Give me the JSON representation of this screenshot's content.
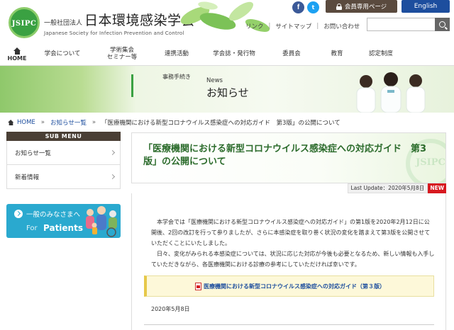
{
  "header": {
    "logo_text": "JSIPC",
    "org_prefix": "一般社団法人",
    "org_name": "日本環境感染学会",
    "org_name_en": "Japanese Society for Infection Prevention and Control",
    "facebook_label": "f",
    "twitter_label": "t",
    "member_page": "会員専用ページ",
    "english": "English",
    "util_links": [
      "リンク",
      "サイトマップ",
      "お問い合わせ"
    ],
    "search_placeholder": ""
  },
  "nav": {
    "home": "HOME",
    "items": [
      "学会について",
      "学術集会\nセミナー等",
      "連携活動",
      "学会誌・発行物",
      "委員会",
      "教育",
      "認定制度"
    ]
  },
  "banner": {
    "tag": "事務手続き",
    "title_en": "News",
    "title": "お知らせ"
  },
  "breadcrumb": {
    "home": "HOME",
    "parent": "お知らせ一覧",
    "current": "「医療機関における新型コロナウイルス感染症への対応ガイド　第3版」の公開について"
  },
  "sidebar": {
    "title": "SUB MENU",
    "items": [
      "お知らせ一覧",
      "新着情報"
    ],
    "patients_jp": "一般のみなさまへ",
    "patients_en_1": "For",
    "patients_en_2": "Patients"
  },
  "article": {
    "title": "「医療機関における新型コロナウイルス感染症への対応ガイド　第3版」の公開について",
    "update": "Last Update：2020年5月8日",
    "new_badge": "NEW",
    "para1": "　本学会では「医療機関における新型コロナウイルス感染症への対応ガイド」の第1版を2020年2月12日に公開後、2回の改訂を行って参りましたが、さらに本感染症を取り巻く状況の変化を踏まえて第3版を公開させていただくことにいたしました。",
    "para2": "　日々、変化がみられる本感染症については、状況に応じた対応が今後も必要となるため、新しい情報も入手していただきながら、各医療機関における診療の参考にしていただければ幸いです。",
    "pdf_link": "医療機関における新型コロナウイルス感染症への対応ガイド（第３版）",
    "date": "2020年5月8日"
  }
}
